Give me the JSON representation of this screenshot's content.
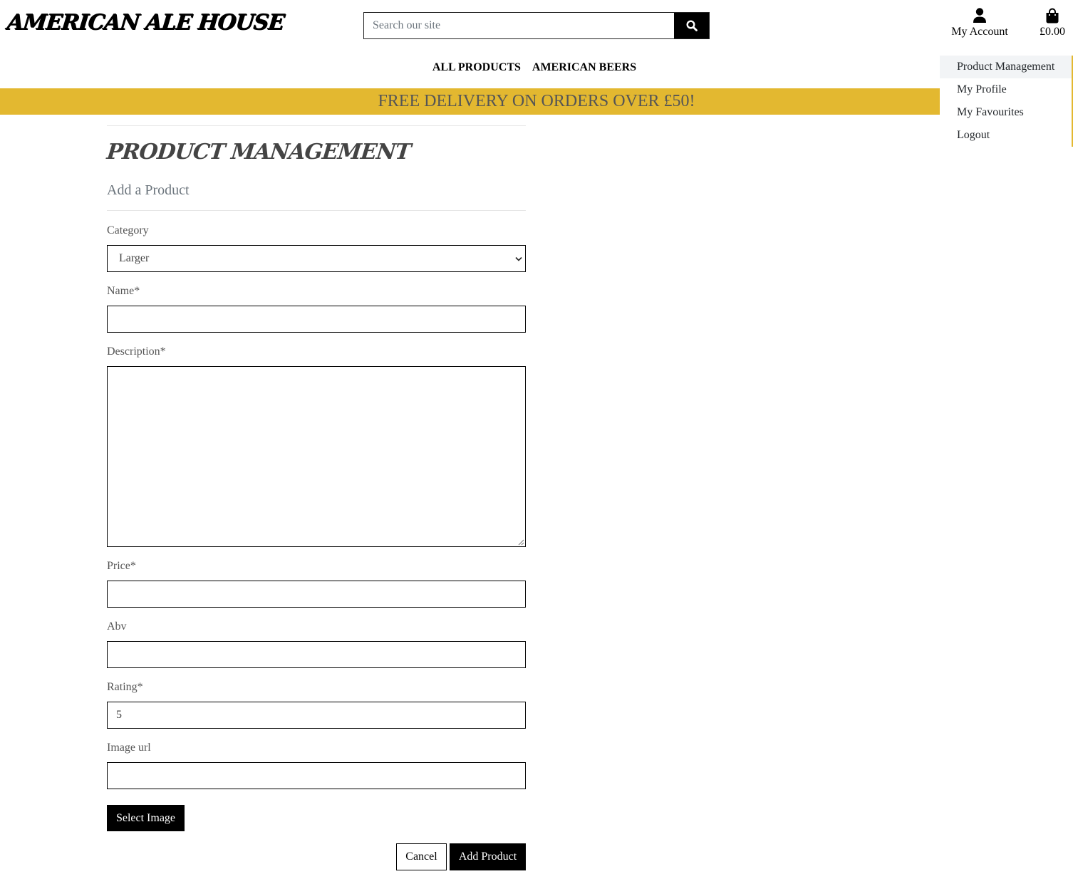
{
  "header": {
    "logo": "AMERICAN ALE HOUSE",
    "search_placeholder": "Search our site",
    "account_label": "My Account",
    "basket_total": "£0.00"
  },
  "nav": {
    "items": [
      "ALL PRODUCTS",
      "AMERICAN BEERS"
    ]
  },
  "banner": {
    "text": "FREE DELIVERY ON ORDERS OVER £50!",
    "color": "#e3b830"
  },
  "account_menu": {
    "items": [
      "Product Management",
      "My Profile",
      "My Favourites",
      "Logout"
    ]
  },
  "main": {
    "title": "PRODUCT MANAGEMENT",
    "subtitle": "Add a Product",
    "form": {
      "category_label": "Category",
      "category_value": "Larger",
      "name_label": "Name*",
      "name_value": "",
      "description_label": "Description*",
      "description_value": "",
      "price_label": "Price*",
      "price_value": "",
      "abv_label": "Abv",
      "abv_value": "",
      "rating_label": "Rating*",
      "rating_value": "5",
      "image_url_label": "Image url",
      "image_url_value": "",
      "select_image_label": "Select Image",
      "cancel_label": "Cancel",
      "submit_label": "Add Product"
    }
  },
  "icons": {
    "search": "search-icon",
    "account": "user-icon",
    "basket": "shopping-bag-icon",
    "select": "chevron-down-icon"
  }
}
